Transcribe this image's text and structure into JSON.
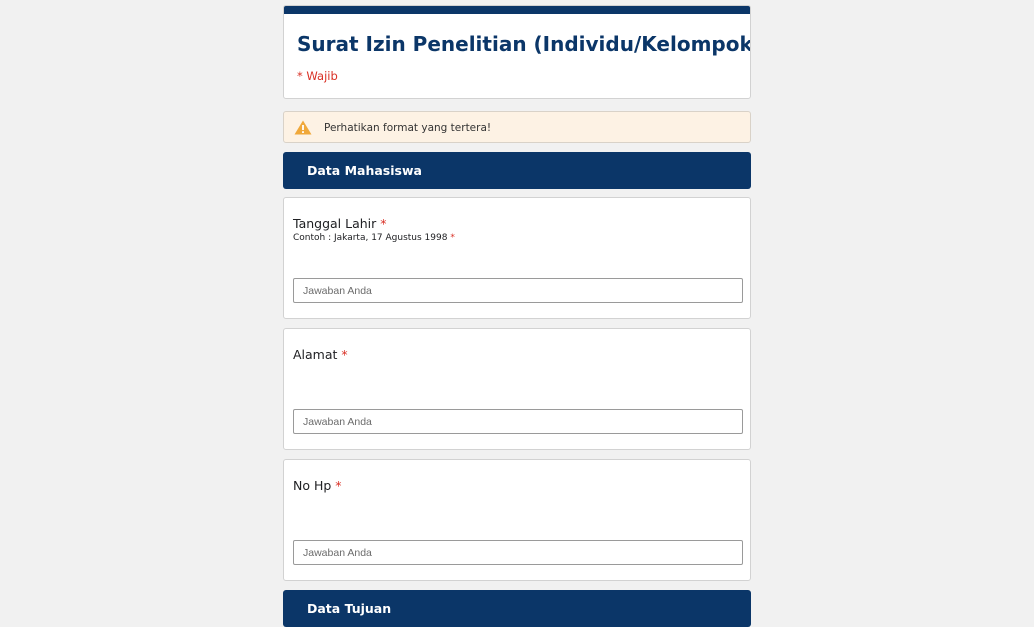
{
  "form": {
    "title": "Surat Izin Penelitian (Individu/Kelompok)",
    "required_note": "* Wajib",
    "accent_color": "#0b3668",
    "required_color": "#d93025"
  },
  "warning": {
    "icon": "warning-icon",
    "text": "Perhatikan format yang tertera!"
  },
  "sections": [
    {
      "title": "Data Mahasiswa"
    },
    {
      "title": "Data Tujuan"
    }
  ],
  "questions": [
    {
      "label": "Tanggal Lahir",
      "required_mark": "*",
      "hint": "Contoh : Jakarta, 17 Agustus 1998",
      "hint_required_mark": "*",
      "placeholder": "Jawaban Anda",
      "value": ""
    },
    {
      "label": "Alamat",
      "required_mark": "*",
      "placeholder": "Jawaban Anda",
      "value": ""
    },
    {
      "label": "No Hp",
      "required_mark": "*",
      "placeholder": "Jawaban Anda",
      "value": ""
    }
  ]
}
